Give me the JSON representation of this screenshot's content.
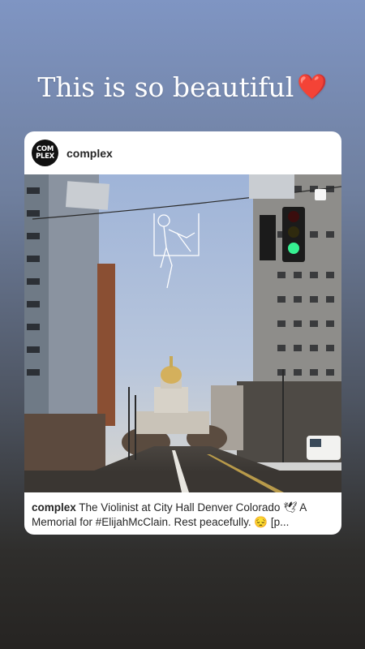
{
  "story": {
    "caption_text": "This is so beautiful",
    "caption_emoji": "❤️"
  },
  "post": {
    "avatar_text_line1": "COM",
    "avatar_text_line2": "PLEX",
    "username": "complex",
    "image_icon": "street-photo-capitol-dome",
    "caption_username": "complex",
    "caption_text": "The Violinist at City Hall Denver Colorado 🕊 A Memorial for #ElijahMcClain. Rest peacefully. 😔 [p..."
  },
  "colors": {
    "sky_top": "#7f95c3",
    "card_bg": "#ffffff",
    "text_primary": "#262626",
    "heart": "#e0243b"
  }
}
